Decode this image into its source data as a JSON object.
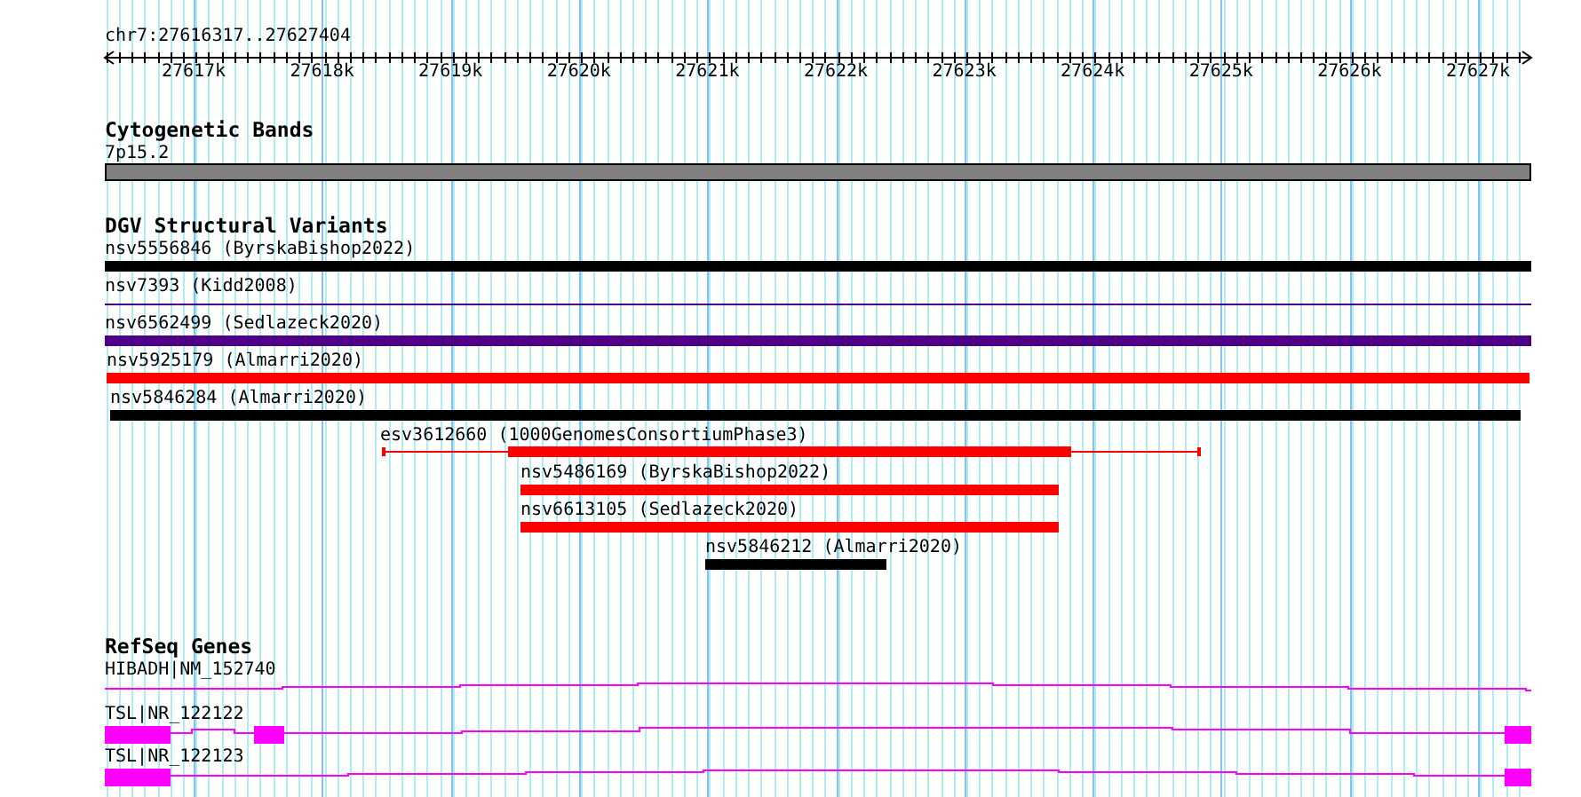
{
  "location": "chr7:27616317..27627404",
  "ruler": {
    "labels": [
      "27617k",
      "27618k",
      "27619k",
      "27620k",
      "27621k",
      "27622k",
      "27623k",
      "27624k",
      "27625k",
      "27626k",
      "27627k"
    ]
  },
  "tracks": [
    {
      "title": "Cytogenetic Bands",
      "features": [
        {
          "label": "7p15.2",
          "kind": "band",
          "color": "#808080"
        }
      ]
    },
    {
      "title": "DGV Structural Variants",
      "features": [
        {
          "label": "nsv5556846 (ByrskaBishop2022)",
          "kind": "bar",
          "color": "#000000"
        },
        {
          "label": "nsv7393 (Kidd2008)",
          "kind": "line",
          "color": "#4b0082"
        },
        {
          "label": "nsv6562499 (Sedlazeck2020)",
          "kind": "bar",
          "color": "#4b0082"
        },
        {
          "label": "nsv5925179 (Almarri2020)",
          "kind": "bar",
          "color": "#ff0000"
        },
        {
          "label": "nsv5846284 (Almarri2020)",
          "kind": "bar",
          "color": "#000000"
        },
        {
          "label": "esv3612660 (1000GenomesConsortiumPhase3)",
          "kind": "split",
          "color": "#ff0000"
        },
        {
          "label": "nsv5486169 (ByrskaBishop2022)",
          "kind": "bar",
          "color": "#ff0000"
        },
        {
          "label": "nsv6613105 (Sedlazeck2020)",
          "kind": "bar",
          "color": "#ff0000"
        },
        {
          "label": "nsv5846212 (Almarri2020)",
          "kind": "bar",
          "color": "#000000"
        }
      ]
    },
    {
      "title": "RefSeq Genes",
      "features": [
        {
          "label": "HIBADH|NM_152740",
          "kind": "gene",
          "color": "#ff00ff"
        },
        {
          "label": "TSL|NR_122122",
          "kind": "gene",
          "color": "#ff00ff"
        },
        {
          "label": "TSL|NR_122123",
          "kind": "gene",
          "color": "#ff00ff"
        }
      ]
    }
  ]
}
